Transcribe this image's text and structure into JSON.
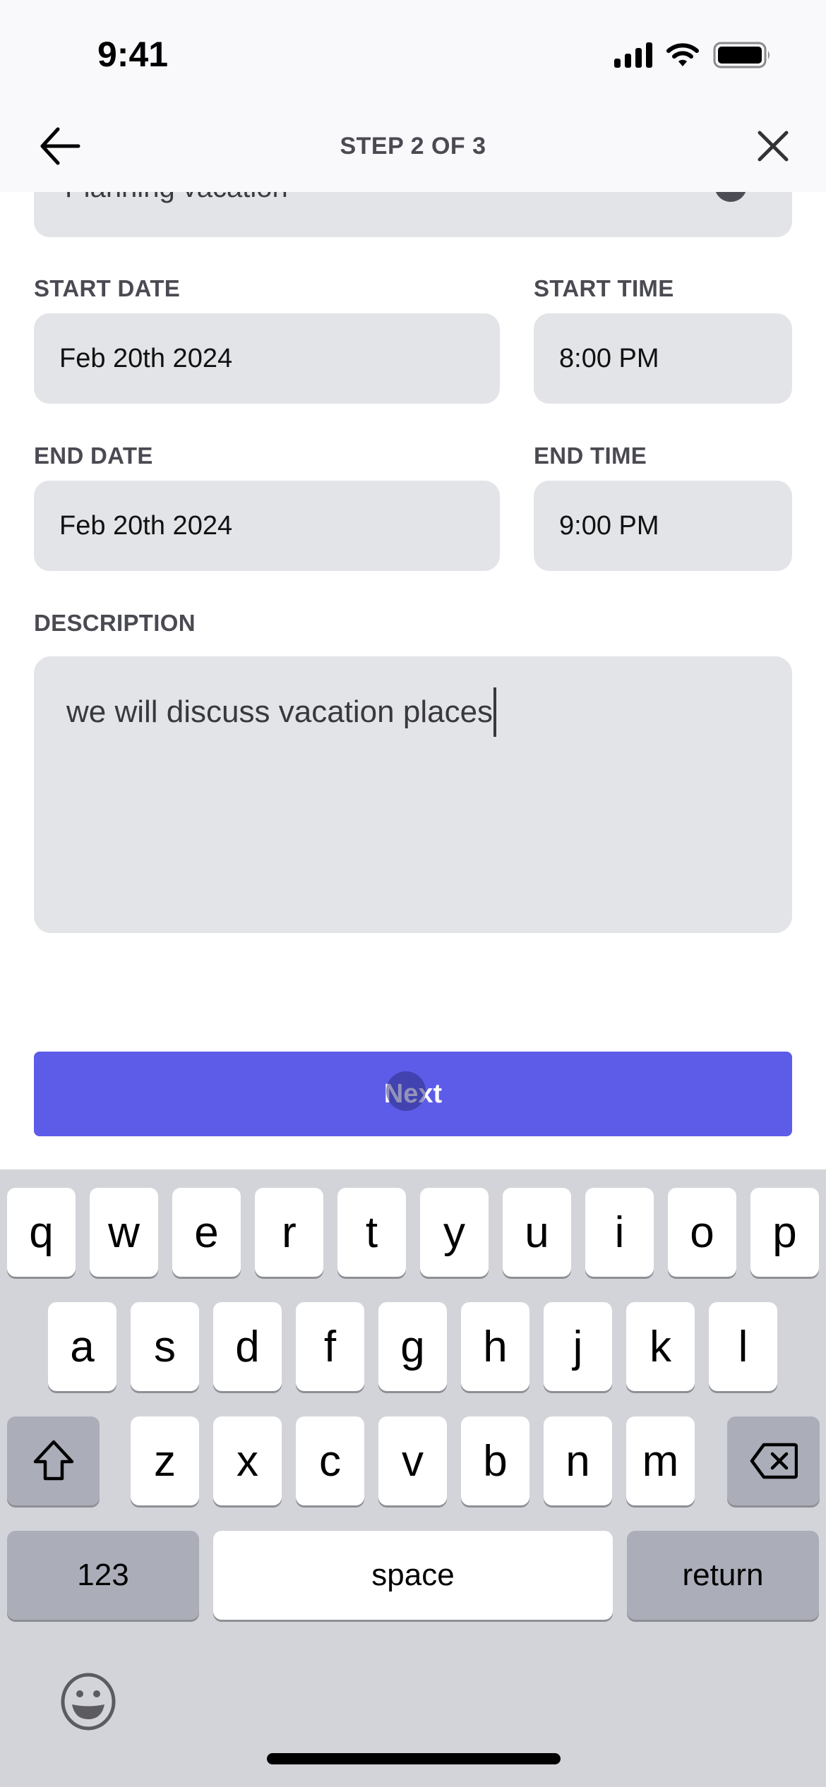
{
  "status_bar": {
    "time": "9:41",
    "icons": [
      "cellular-signal-icon",
      "wifi-icon",
      "battery-icon"
    ]
  },
  "header": {
    "back_icon": "arrow-left-icon",
    "title": "STEP 2 OF 3",
    "close_icon": "close-x-icon"
  },
  "form": {
    "title_field": {
      "value": "Planning vacation",
      "clear_icon": "clear-circle-icon"
    },
    "start_date": {
      "label": "START DATE",
      "value": "Feb 20th 2024"
    },
    "start_time": {
      "label": "START TIME",
      "value": "8:00 PM"
    },
    "end_date": {
      "label": "END DATE",
      "value": "Feb 20th 2024"
    },
    "end_time": {
      "label": "END TIME",
      "value": "9:00 PM"
    },
    "description": {
      "label": "DESCRIPTION",
      "value": "we will discuss vacation places"
    },
    "next_label": "Next"
  },
  "colors": {
    "accent": "#5d5ce9",
    "field_bg": "#e3e4e8",
    "label": "#4a4a52"
  },
  "keyboard": {
    "row1": [
      "q",
      "w",
      "e",
      "r",
      "t",
      "y",
      "u",
      "i",
      "o",
      "p"
    ],
    "row2": [
      "a",
      "s",
      "d",
      "f",
      "g",
      "h",
      "j",
      "k",
      "l"
    ],
    "row3": [
      "z",
      "x",
      "c",
      "v",
      "b",
      "n",
      "m"
    ],
    "shift_icon": "shift-arrow-icon",
    "delete_icon": "backspace-icon",
    "numbers_label": "123",
    "space_label": "space",
    "return_label": "return",
    "emoji_icon": "emoji-face-icon"
  }
}
